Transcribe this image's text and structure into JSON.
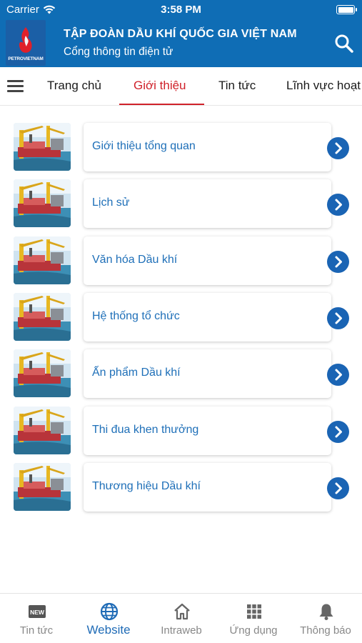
{
  "status_bar": {
    "carrier": "Carrier",
    "time": "3:58 PM"
  },
  "header": {
    "logo_text": "PETROVIETNAM",
    "title": "TẬP ĐOÀN DẦU KHÍ QUỐC GIA VIỆT NAM",
    "subtitle": "Cổng thông tin điện tử"
  },
  "tabs": [
    {
      "label": "Trang chủ",
      "active": false
    },
    {
      "label": "Giới thiệu",
      "active": true
    },
    {
      "label": "Tin tức",
      "active": false
    },
    {
      "label": "Lĩnh vực hoạt",
      "active": false
    }
  ],
  "items": [
    {
      "label": "Giới thiệu tổng quan"
    },
    {
      "label": "Lịch sử"
    },
    {
      "label": "Văn hóa Dầu khí"
    },
    {
      "label": "Hệ thống tổ chức"
    },
    {
      "label": "Ấn phẩm Dầu khí"
    },
    {
      "label": "Thi đua khen thưởng"
    },
    {
      "label": "Thương hiệu Dầu khí"
    }
  ],
  "bottom_tabs": [
    {
      "label": "Tin tức",
      "icon": "news-icon",
      "active": false
    },
    {
      "label": "Website",
      "icon": "globe-icon",
      "active": true
    },
    {
      "label": "Intraweb",
      "icon": "home-icon",
      "active": false
    },
    {
      "label": "Ứng dụng",
      "icon": "apps-grid-icon",
      "active": false
    },
    {
      "label": "Thông báo",
      "icon": "bell-icon",
      "active": false
    }
  ],
  "colors": {
    "primary": "#0f6db5",
    "accent": "#d0212a",
    "link": "#1e6fb8"
  }
}
